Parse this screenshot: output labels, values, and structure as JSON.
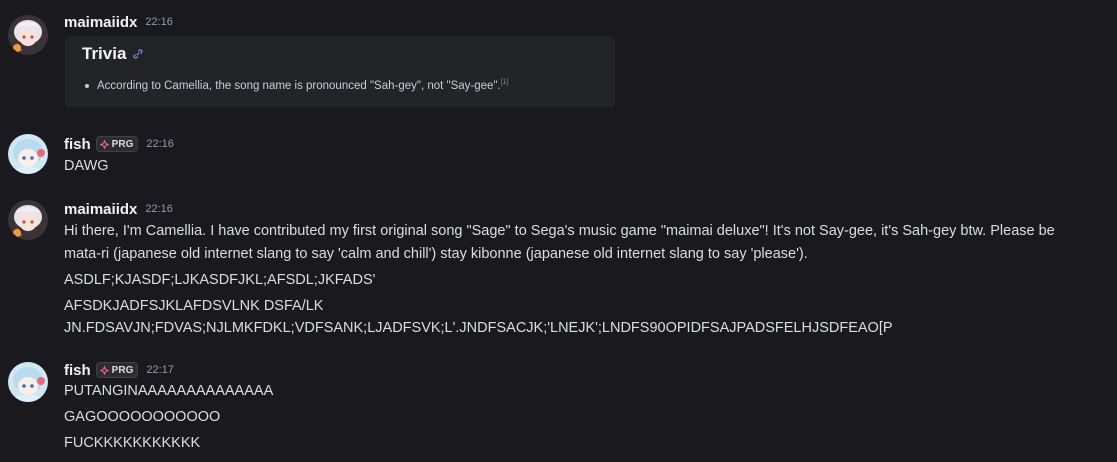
{
  "messages": [
    {
      "username": "maimaiidx",
      "timestamp": "22:16",
      "embed": {
        "title": "Trivia",
        "bullet": "According to Camellia, the song name is pronounced \"Sah-gey\", not \"Say-gee\".",
        "footnote": "[1]"
      }
    },
    {
      "username": "fish",
      "tag": "PRG",
      "timestamp": "22:16",
      "lines": [
        "DAWG"
      ]
    },
    {
      "username": "maimaiidx",
      "timestamp": "22:16",
      "lines": [
        "Hi there, I'm Camellia. I have contributed my first original song \"Sage\" to Sega's music game \"maimai deluxe\"! It's not Say-gee, it's Sah-gey btw. Please be",
        "mata-ri (japanese old internet slang to say 'calm and chill') stay kibonne (japanese old internet slang to say 'please').",
        "ASDLF;KJASDF;LJKASDFJKL;AFSDL;JKFADS'",
        "AFSDKJADFSJKLAFDSVLNK DSFA/LK",
        "JN.FDSAVJN;FDVAS;NJLMKFDKL;VDFSANK;LJADFSVK;L'.JNDFSACJK;'LNEJK';LNDFS90OPIDFSAJPADSFELHJSDFEAO[P"
      ]
    },
    {
      "username": "fish",
      "tag": "PRG",
      "timestamp": "22:17",
      "lines": [
        "PUTANGINAAAAAAAAAAAAAA",
        "GAGOOOOOOOOOOO",
        "FUCKKKKKKKKKKK"
      ]
    }
  ],
  "icons": {
    "link": "link-icon",
    "tag": "guild-tag-icon"
  },
  "colors": {
    "background": "#1a1a1e",
    "embed_background": "#232428",
    "text": "#dbdee1",
    "username": "#f2f3f5",
    "timestamp": "#949ba4",
    "tag_icon": "#f06292"
  }
}
